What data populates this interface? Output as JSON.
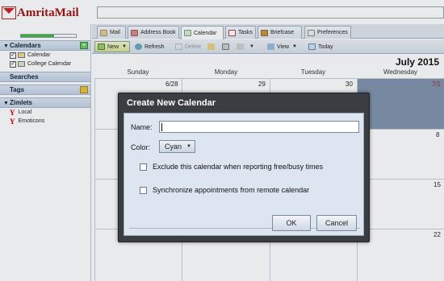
{
  "app": {
    "brand": "AmritaMail"
  },
  "quota": {
    "percent": 60
  },
  "sidebar": {
    "calendars_header": "Calendars",
    "calendars": [
      {
        "label": "Calendar",
        "checked": true,
        "color": "#f5d890"
      },
      {
        "label": "College Calendar",
        "checked": true,
        "color": "#d8e8c8"
      }
    ],
    "searches_header": "Searches",
    "tags_header": "Tags",
    "zimlets_header": "Zimlets",
    "zimlets": [
      {
        "label": "Local",
        "icon": "yahoo-icon"
      },
      {
        "label": "Emoticons",
        "icon": "yahoo-icon"
      }
    ]
  },
  "tabs": [
    {
      "label": "Mail",
      "icon": "mail-icon"
    },
    {
      "label": "Address Book",
      "icon": "address-book-icon"
    },
    {
      "label": "Calendar",
      "icon": "calendar-icon",
      "active": true
    },
    {
      "label": "Tasks",
      "icon": "tasks-icon"
    },
    {
      "label": "Briefcase",
      "icon": "briefcase-icon"
    },
    {
      "label": "Preferences",
      "icon": "preferences-icon"
    }
  ],
  "toolbar": {
    "new_label": "New",
    "refresh_label": "Refresh",
    "delete_label": "Delete",
    "view_label": "View",
    "today_label": "Today"
  },
  "calendar": {
    "month_title": "July 2015",
    "day_names": [
      "Sunday",
      "Monday",
      "Tuesday",
      "Wednesday"
    ],
    "dates": {
      "row1": [
        "6/28",
        "29",
        "30",
        "7/1"
      ],
      "row2_wed": "8",
      "row3_wed": "15",
      "row4_wed": "22"
    }
  },
  "dialog": {
    "title": "Create New Calendar",
    "name_label": "Name:",
    "name_value": "",
    "color_label": "Color:",
    "color_value": "Cyan",
    "exclude_label": "Exclude this calendar when reporting free/busy times",
    "exclude_checked": false,
    "sync_label": "Synchronize appointments from remote calendar",
    "sync_checked": false,
    "ok_label": "OK",
    "cancel_label": "Cancel"
  }
}
